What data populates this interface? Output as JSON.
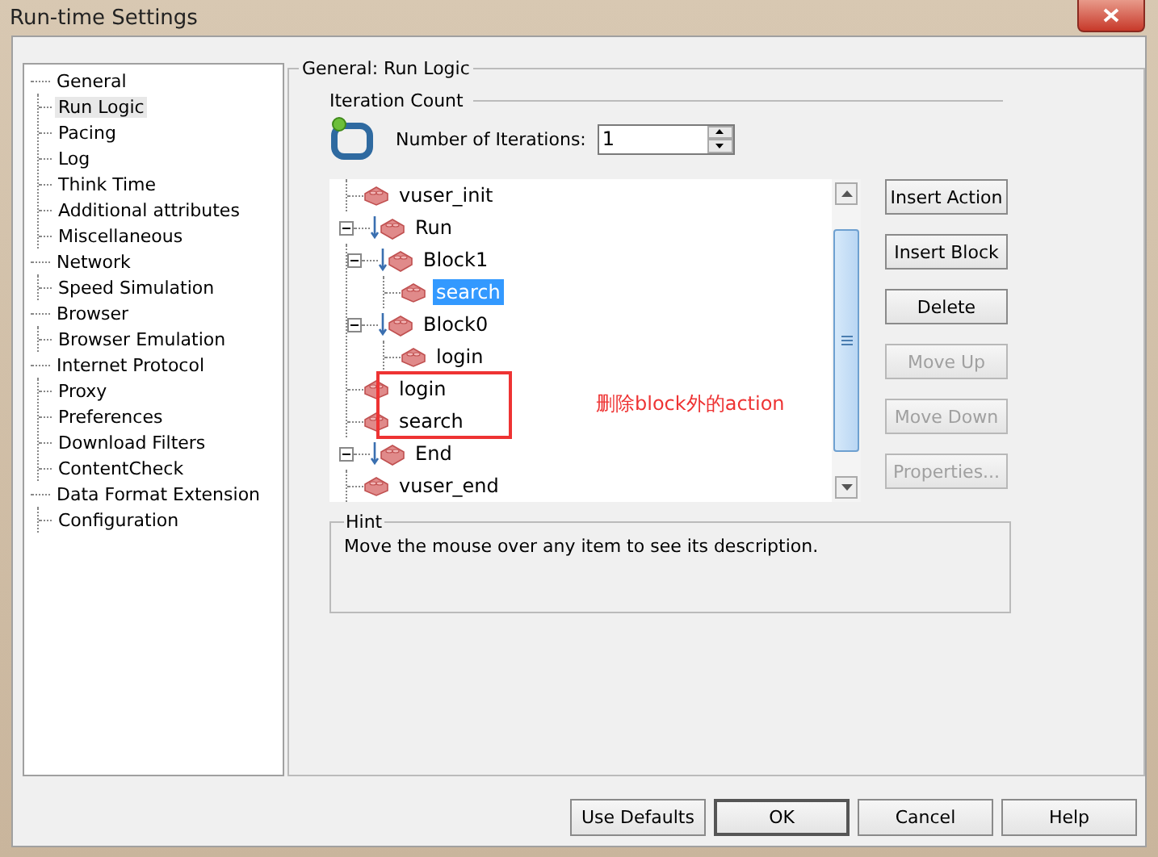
{
  "window": {
    "title": "Run-time Settings"
  },
  "nav_tree": [
    {
      "label": "General",
      "selected": false,
      "children": [
        {
          "label": "Run Logic",
          "selected": true
        },
        {
          "label": "Pacing",
          "selected": false
        },
        {
          "label": "Log",
          "selected": false
        },
        {
          "label": "Think Time",
          "selected": false
        },
        {
          "label": "Additional attributes",
          "selected": false
        },
        {
          "label": "Miscellaneous",
          "selected": false
        }
      ]
    },
    {
      "label": "Network",
      "selected": false,
      "children": [
        {
          "label": "Speed Simulation",
          "selected": false
        }
      ]
    },
    {
      "label": "Browser",
      "selected": false,
      "children": [
        {
          "label": "Browser Emulation",
          "selected": false
        }
      ]
    },
    {
      "label": "Internet Protocol",
      "selected": false,
      "children": [
        {
          "label": "Proxy",
          "selected": false
        },
        {
          "label": "Preferences",
          "selected": false
        },
        {
          "label": "Download Filters",
          "selected": false
        },
        {
          "label": "ContentCheck",
          "selected": false
        }
      ]
    },
    {
      "label": "Data Format Extension",
      "selected": false,
      "children": [
        {
          "label": "Configuration",
          "selected": false
        }
      ]
    }
  ],
  "panel": {
    "title": "General: Run Logic",
    "iteration_count": {
      "heading": "Iteration Count",
      "label": "Number of Iterations:",
      "value": "1"
    },
    "action_tree": [
      {
        "kind": "section",
        "children": [
          {
            "label": "vuser_init",
            "kind": "action",
            "selected": false
          }
        ]
      },
      {
        "label": "Run",
        "kind": "section",
        "expanded": true,
        "children": [
          {
            "label": "Block1",
            "kind": "block",
            "expanded": true,
            "children": [
              {
                "label": "search",
                "kind": "action",
                "selected": true
              }
            ]
          },
          {
            "label": "Block0",
            "kind": "block",
            "expanded": true,
            "children": [
              {
                "label": "login",
                "kind": "action",
                "selected": false
              }
            ]
          },
          {
            "label": "login",
            "kind": "action",
            "selected": false,
            "marked": true
          },
          {
            "label": "search",
            "kind": "action",
            "selected": false,
            "marked": true
          }
        ]
      },
      {
        "label": "End",
        "kind": "section",
        "expanded": true,
        "children": [
          {
            "label": "vuser_end",
            "kind": "action",
            "selected": false
          }
        ]
      }
    ],
    "annotation": "删除block外的action",
    "buttons": [
      {
        "label": "Insert Action",
        "disabled": false
      },
      {
        "label": "Insert Block",
        "disabled": false
      },
      {
        "label": "Delete",
        "disabled": false
      },
      {
        "label": "Move Up",
        "disabled": true
      },
      {
        "label": "Move Down",
        "disabled": true
      },
      {
        "label": "Properties...",
        "disabled": true
      }
    ],
    "hint": {
      "title": "Hint",
      "text": "Move the mouse over any item to see its description."
    }
  },
  "footer_buttons": [
    {
      "label": "Use Defaults",
      "default": false
    },
    {
      "label": "OK",
      "default": true
    },
    {
      "label": "Cancel",
      "default": false
    },
    {
      "label": "Help",
      "default": false
    }
  ]
}
